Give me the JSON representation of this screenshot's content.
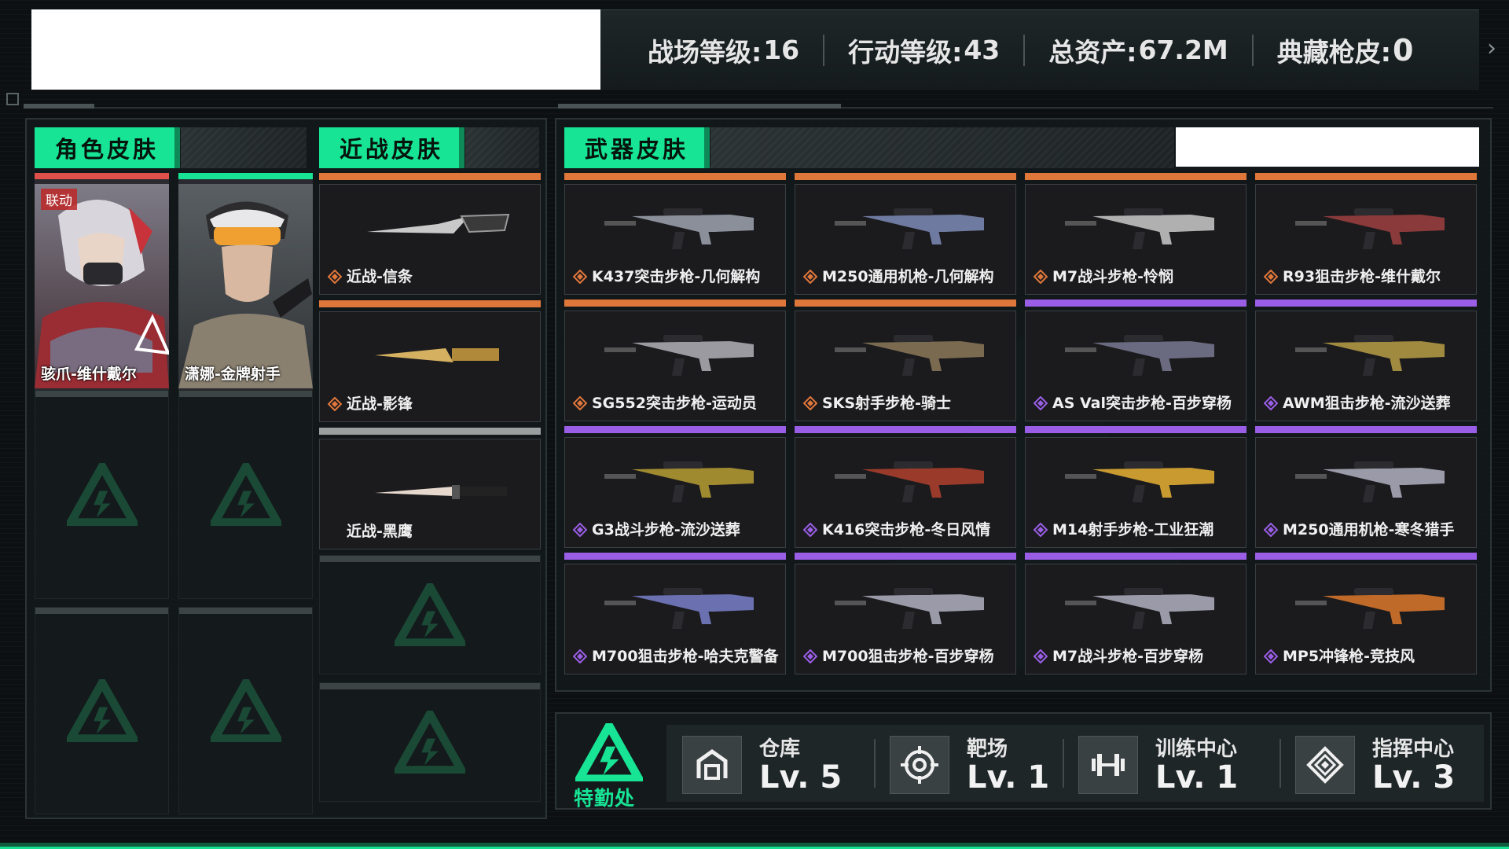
{
  "header": {
    "stats": [
      {
        "label": "战场等级:",
        "value": "16"
      },
      {
        "label": "行动等级: ",
        "value": "43"
      },
      {
        "label": "总资产:",
        "value": "67.2M"
      },
      {
        "label": "典藏枪皮:",
        "value": "0"
      }
    ],
    "next_icon": "chevron-right-icon"
  },
  "character_section": {
    "title": "角色皮肤",
    "cards": [
      {
        "label": "骇爪-维什戴尔",
        "badge": "联动",
        "rarity_color": "#e0504a"
      },
      {
        "label": "潇娜-金牌射手",
        "badge": "",
        "rarity_color": "#17e494"
      }
    ]
  },
  "melee_section": {
    "title": "近战皮肤",
    "items": [
      {
        "label": "近战-信条",
        "rarity": "orange"
      },
      {
        "label": "近战-影锋",
        "rarity": "orange"
      },
      {
        "label": "近战-黑鹰",
        "rarity": "gray"
      }
    ]
  },
  "weapon_section": {
    "title": "武器皮肤",
    "items": [
      {
        "label": "K437突击步枪-几何解构",
        "rarity": "orange"
      },
      {
        "label": "M250通用机枪-几何解构",
        "rarity": "orange"
      },
      {
        "label": "M7战斗步枪-怜悯",
        "rarity": "orange"
      },
      {
        "label": "R93狙击步枪-维什戴尔",
        "rarity": "orange"
      },
      {
        "label": "SG552突击步枪-运动员",
        "rarity": "orange"
      },
      {
        "label": "SKS射手步枪-骑士",
        "rarity": "orange"
      },
      {
        "label": "AS Val突击步枪-百步穿杨",
        "rarity": "purple"
      },
      {
        "label": "AWM狙击步枪-流沙送葬",
        "rarity": "purple"
      },
      {
        "label": "G3战斗步枪-流沙送葬",
        "rarity": "purple"
      },
      {
        "label": "K416突击步枪-冬日风情",
        "rarity": "purple"
      },
      {
        "label": "M14射手步枪-工业狂潮",
        "rarity": "purple"
      },
      {
        "label": "M250通用机枪-寒冬猎手",
        "rarity": "purple"
      },
      {
        "label": "M700狙击步枪-哈夫克警备",
        "rarity": "purple"
      },
      {
        "label": "M700狙击步枪-百步穿杨",
        "rarity": "purple"
      },
      {
        "label": "M7战斗步枪-百步穿杨",
        "rarity": "purple"
      },
      {
        "label": "MP5冲锋枪-竞技风",
        "rarity": "purple"
      }
    ]
  },
  "colors": {
    "accent": "#17e494",
    "orange": "#e0773a",
    "purple": "#9a5ee6",
    "gray": "#9aa0a0"
  },
  "footer": {
    "hq_label": "特勤处",
    "facilities": [
      {
        "name": "仓库",
        "level": "Lv. 5",
        "icon": "warehouse-icon"
      },
      {
        "name": "靶场",
        "level": "Lv. 1",
        "icon": "target-icon"
      },
      {
        "name": "训练中心",
        "level": "Lv. 1",
        "icon": "dumbbell-icon"
      },
      {
        "name": "指挥中心",
        "level": "Lv. 3",
        "icon": "command-icon"
      }
    ]
  }
}
